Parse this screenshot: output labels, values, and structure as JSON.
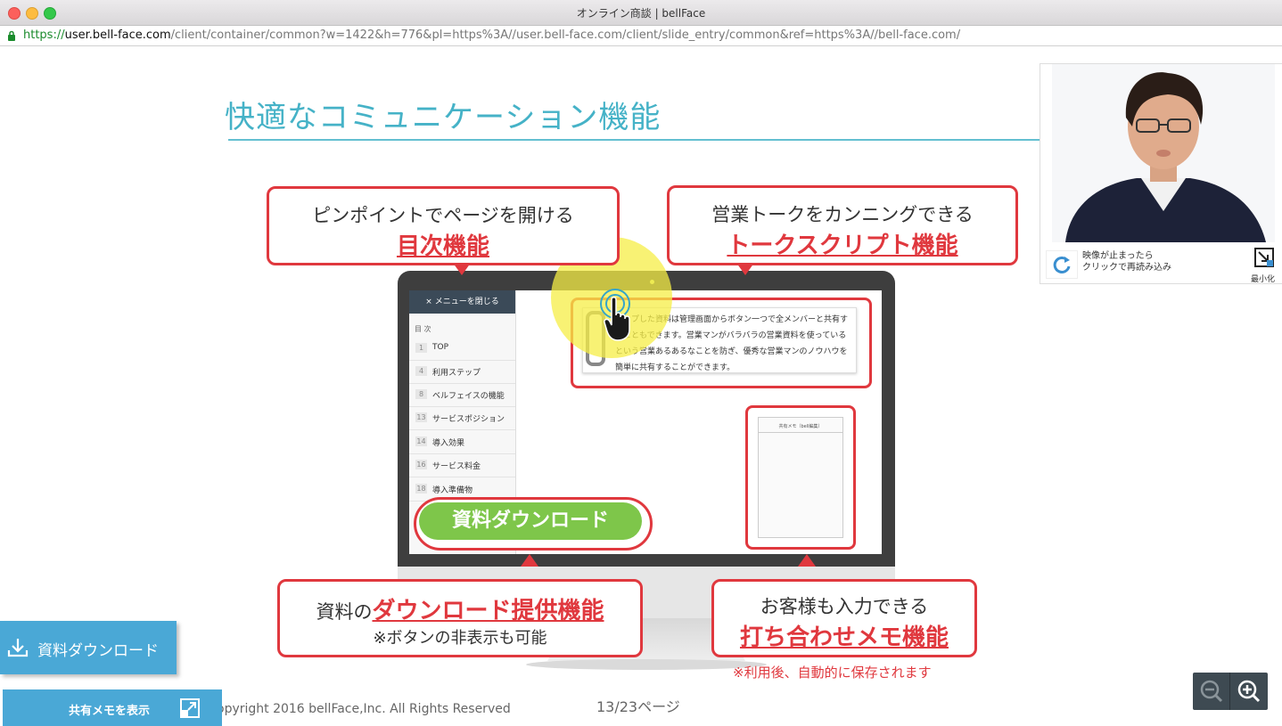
{
  "window": {
    "title": "オンライン商談 | bellFace"
  },
  "url": {
    "scheme": "https://",
    "host": "user.bell-face.com",
    "path": "/client/container/common?w=1422&h=776&pl=https%3A//user.bell-face.com/client/slide_entry/common&ref=https%3A//bell-face.com/"
  },
  "slide": {
    "title": "快適なコミュニケーション機能",
    "callout_toc": {
      "line1": "ピンポイントでページを開ける",
      "line2": "目次機能"
    },
    "callout_script": {
      "line1": "営業トークをカンニングできる",
      "line2": "トークスクリプト機能"
    },
    "callout_download": {
      "prefix": "資料の",
      "emph": "ダウンロード提供機能",
      "line2": "※ボタンの非表示も可能"
    },
    "callout_memo": {
      "line1": "お客様も入力できる",
      "line2": "打ち合わせメモ機能"
    },
    "note": "※利用後、自動的に保存されます",
    "menu": {
      "close_label": "メニューを閉じる",
      "toc_label": "目 次",
      "items": [
        {
          "num": "1",
          "label": "TOP"
        },
        {
          "num": "4",
          "label": "利用ステップ"
        },
        {
          "num": "8",
          "label": "ベルフェイスの機能"
        },
        {
          "num": "13",
          "label": "サービスポジション"
        },
        {
          "num": "14",
          "label": "導入効果"
        },
        {
          "num": "16",
          "label": "サービス料金"
        },
        {
          "num": "18",
          "label": "導入準備物"
        }
      ]
    },
    "script_text": "アップした資料は管理画面からボタン一つで全メンバーと共有することもできます。営業マンがバラバラの営業資料を使っているという営業あるあるなことを防ぎ、優秀な営業マンのノウハウを簡単に共有することができます。",
    "memo_title": "共有メモ（bell編集）",
    "download_button": "資料ダウンロード"
  },
  "footer": {
    "copyright": "opyright 2016 bellFace,Inc. All Rights Reserved",
    "page": "13/23ページ"
  },
  "video": {
    "reload_text_1": "映像が止まったら",
    "reload_text_2": "クリックで再読み込み",
    "minimize_label": "最小化"
  },
  "sidebar": {
    "download_label": "資料ダウンロード",
    "memo_label": "共有メモを表示"
  },
  "colors": {
    "accent": "#45b2c7",
    "red": "#e0383e",
    "green": "#7ec64a",
    "button_blue": "#4aa8d6"
  }
}
